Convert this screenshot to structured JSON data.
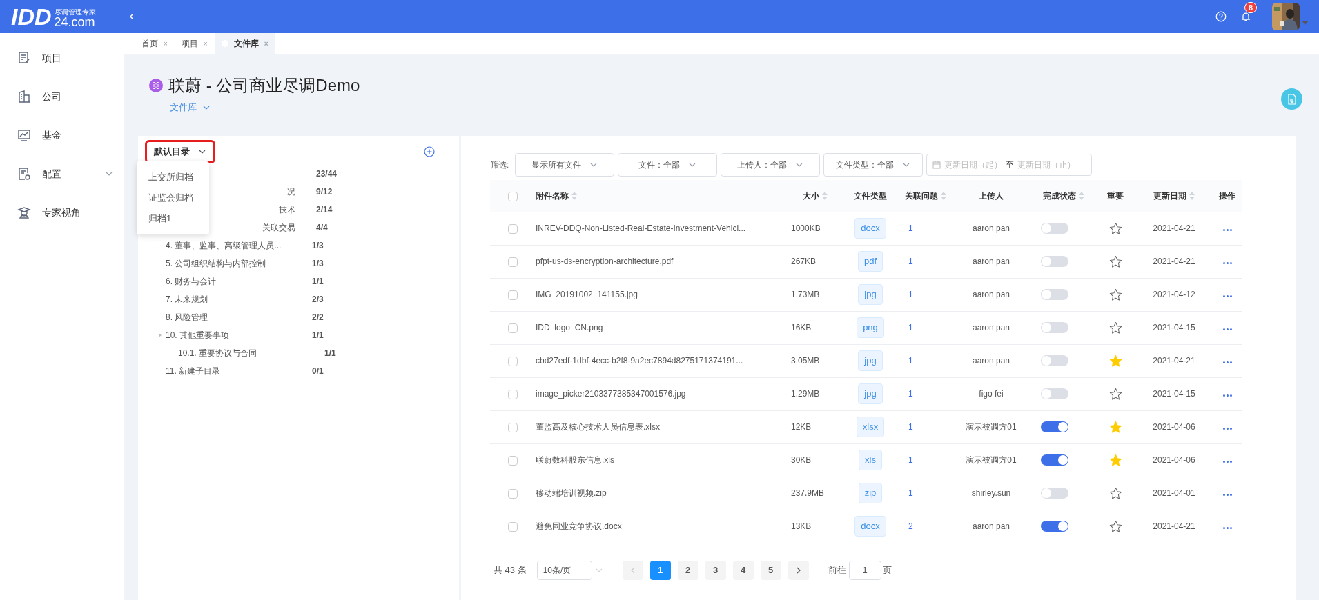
{
  "header": {
    "logo_main": "IDD",
    "logo_sub": "24.com",
    "logo_tagline": "尽调管理专家",
    "notifications": "8"
  },
  "sidebar": {
    "items": [
      {
        "label": "项目",
        "kind": "doc",
        "expandable": false
      },
      {
        "label": "公司",
        "kind": "building",
        "expandable": false
      },
      {
        "label": "基金",
        "kind": "chart",
        "expandable": false
      },
      {
        "label": "配置",
        "kind": "config",
        "expandable": true
      },
      {
        "label": "专家视角",
        "kind": "expert",
        "expandable": false
      }
    ]
  },
  "tabs": [
    {
      "label": "首页",
      "close": "×",
      "selected": false
    },
    {
      "label": "项目",
      "close": "×",
      "selected": false
    },
    {
      "label": "文件库",
      "close": "×",
      "selected": true
    }
  ],
  "page": {
    "title": "联蔚 - 公司商业尽调Demo",
    "breadcrumb": "文件库"
  },
  "directory": {
    "label": "默认目录",
    "menu": [
      "上交所归档",
      "证监会归档",
      "归档1"
    ],
    "tree": [
      {
        "count": "23/44",
        "covered": true
      },
      {
        "label": "况",
        "count": "9/12",
        "covered": true
      },
      {
        "label": "技术",
        "count": "2/14",
        "covered": true
      },
      {
        "label": "关联交易",
        "count": "4/4",
        "covered": true
      },
      {
        "label": "4. 董事、监事、高级管理人员...",
        "count": "1/3",
        "covered": false
      },
      {
        "label": "5. 公司组织结构与内部控制",
        "count": "1/3",
        "covered": false
      },
      {
        "label": "6. 财务与会计",
        "count": "1/1",
        "covered": false
      },
      {
        "label": "7. 未来规划",
        "count": "2/3",
        "covered": false
      },
      {
        "label": "8. 风险管理",
        "count": "2/2",
        "covered": false
      },
      {
        "label": "10. 其他重要事项",
        "count": "1/1",
        "covered": false,
        "children": [
          {
            "label": "10.1. 重要协议与合同",
            "count": "1/1",
            "covered": false
          }
        ]
      },
      {
        "label": "11. 新建子目录",
        "count": "0/1",
        "covered": false
      }
    ]
  },
  "filters": {
    "label": "筛选:",
    "selects": [
      "显示所有文件",
      "文件：全部",
      "上传人：全部",
      "文件类型：全部"
    ],
    "date_from": "更新日期（起）",
    "date_sep": "至",
    "date_to": "更新日期（止）"
  },
  "table": {
    "select_all_checked": false,
    "columns": [
      {
        "label": "附件名称",
        "sortable": true
      },
      {
        "label": "大小",
        "sortable": true
      },
      {
        "label": "文件类型",
        "sortable": false
      },
      {
        "label": "关联问题",
        "sortable": true
      },
      {
        "label": "上传人",
        "sortable": false
      },
      {
        "label": "完成状态",
        "sortable": true
      },
      {
        "label": "重要",
        "sortable": false
      },
      {
        "label": "更新日期",
        "sortable": true
      },
      {
        "label": "操作",
        "sortable": false
      }
    ],
    "rows": [
      {
        "name": "INREV-DDQ-Non-Listed-Real-Estate-Investment-Vehicl...",
        "size": "1000KB",
        "type": "docx",
        "issues": "1",
        "uploader": "aaron pan",
        "done": false,
        "important": false,
        "date": "2021-04-21",
        "checked": false
      },
      {
        "name": "pfpt-us-ds-encryption-architecture.pdf",
        "size": "267KB",
        "type": "pdf",
        "issues": "1",
        "uploader": "aaron pan",
        "done": false,
        "important": false,
        "date": "2021-04-21",
        "checked": false
      },
      {
        "name": "IMG_20191002_141155.jpg",
        "size": "1.73MB",
        "type": "jpg",
        "issues": "1",
        "uploader": "aaron pan",
        "done": false,
        "important": false,
        "date": "2021-04-12",
        "checked": false
      },
      {
        "name": "IDD_logo_CN.png",
        "size": "16KB",
        "type": "png",
        "issues": "1",
        "uploader": "aaron pan",
        "done": false,
        "important": false,
        "date": "2021-04-15",
        "checked": false
      },
      {
        "name": "cbd27edf-1dbf-4ecc-b2f8-9a2ec7894d8275171374191...",
        "size": "3.05MB",
        "type": "jpg",
        "issues": "1",
        "uploader": "aaron pan",
        "done": false,
        "important": true,
        "date": "2021-04-21",
        "checked": false
      },
      {
        "name": "image_picker2103377385347001576.jpg",
        "size": "1.29MB",
        "type": "jpg",
        "issues": "1",
        "uploader": "figo fei",
        "done": false,
        "important": false,
        "date": "2021-04-15",
        "checked": false
      },
      {
        "name": "董监高及核心技术人员信息表.xlsx",
        "size": "12KB",
        "type": "xlsx",
        "issues": "1",
        "uploader": "演示被调方01",
        "done": true,
        "important": true,
        "date": "2021-04-06",
        "checked": false
      },
      {
        "name": "联蔚数科股东信息.xls",
        "size": "30KB",
        "type": "xls",
        "issues": "1",
        "uploader": "演示被调方01",
        "done": true,
        "important": true,
        "date": "2021-04-06",
        "checked": false
      },
      {
        "name": "移动端培训视频.zip",
        "size": "237.9MB",
        "type": "zip",
        "issues": "1",
        "uploader": "shirley.sun",
        "done": false,
        "important": false,
        "date": "2021-04-01",
        "checked": false
      },
      {
        "name": "避免同业竞争协议.docx",
        "size": "13KB",
        "type": "docx",
        "issues": "2",
        "uploader": "aaron pan",
        "done": true,
        "important": false,
        "date": "2021-04-21",
        "checked": false
      }
    ]
  },
  "pagination": {
    "total": "共 43 条",
    "page_size": "10条/页",
    "pages": [
      {
        "label": "1",
        "selected": true
      },
      {
        "label": "2",
        "selected": false
      },
      {
        "label": "3",
        "selected": false
      },
      {
        "label": "4",
        "selected": false
      },
      {
        "label": "5",
        "selected": false
      }
    ],
    "goto_label": "前往",
    "goto_value": "1",
    "goto_suffix": "页"
  }
}
